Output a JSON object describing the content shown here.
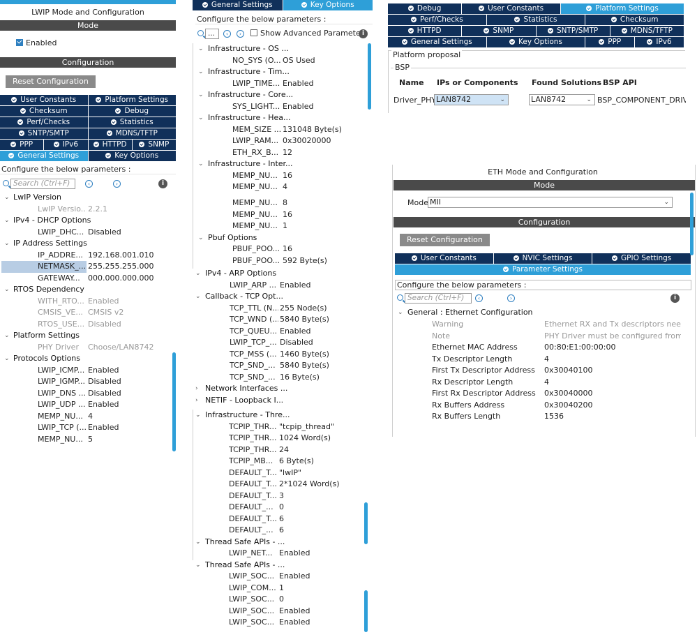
{
  "left": {
    "title": "LWIP Mode and Configuration",
    "mode_bar": "Mode",
    "enabled_label": "Enabled",
    "config_bar": "Configuration",
    "reset_button": "Reset Configuration",
    "tabs": [
      "User Constants",
      "Platform Settings",
      "Checksum",
      "Debug",
      "Perf/Checks",
      "Statistics",
      "SNTP/SMTP",
      "MDNS/TFTP",
      "PPP",
      "IPv6",
      "HTTPD",
      "SNMP",
      "General Settings",
      "Key Options"
    ],
    "hint": "Configure the below parameters :",
    "search_placeholder": "Search (Ctrl+F)",
    "rows": [
      {
        "t": "g",
        "k": "LwIP Version"
      },
      {
        "t": "p",
        "k": "LwIP Versio...",
        "v": "2.2.1",
        "dim": true
      },
      {
        "t": "g",
        "k": "IPv4 - DHCP Options"
      },
      {
        "t": "p",
        "k": "LWIP_DHC...",
        "v": "Disabled"
      },
      {
        "t": "g",
        "k": "IP Address Settings"
      },
      {
        "t": "p",
        "k": "IP_ADDRE...",
        "v": "192.168.001.010"
      },
      {
        "t": "p",
        "k": "NETMASK_...",
        "v": "255.255.255.000",
        "sel": true
      },
      {
        "t": "p",
        "k": "GATEWAY...",
        "v": "000.000.000.000"
      },
      {
        "t": "g",
        "k": "RTOS Dependency"
      },
      {
        "t": "p",
        "k": "WITH_RTO...",
        "v": "Enabled",
        "dim": true
      },
      {
        "t": "p",
        "k": "CMSIS_VE...",
        "v": "CMSIS v2",
        "dim": true
      },
      {
        "t": "p",
        "k": "RTOS_USE...",
        "v": "Disabled",
        "dim": true
      },
      {
        "t": "g",
        "k": "Platform Settings"
      },
      {
        "t": "p",
        "k": "PHY Driver",
        "v": "Choose/LAN8742",
        "dim": true
      },
      {
        "t": "g",
        "k": "Protocols Options"
      },
      {
        "t": "p",
        "k": "LWIP_ICMP...",
        "v": "Enabled"
      },
      {
        "t": "p",
        "k": "LWIP_IGMP...",
        "v": "Disabled"
      },
      {
        "t": "p",
        "k": "LWIP_DNS ...",
        "v": "Disabled"
      },
      {
        "t": "p",
        "k": "LWIP_UDP ...",
        "v": "Enabled"
      },
      {
        "t": "p",
        "k": "MEMP_NU...",
        "v": "4"
      },
      {
        "t": "p",
        "k": "LWIP_TCP (...",
        "v": "Enabled"
      },
      {
        "t": "p",
        "k": "MEMP_NU...",
        "v": "5"
      }
    ]
  },
  "middle": {
    "tabs": [
      "General Settings",
      "Key Options"
    ],
    "hint": "Configure the below parameters :",
    "search_value": "...",
    "advanced_label": "Show Advanced Parameters",
    "rows1": [
      {
        "t": "g",
        "k": "Infrastructure - OS ..."
      },
      {
        "t": "p",
        "k": "NO_SYS (O...",
        "v": "OS Used"
      },
      {
        "t": "g",
        "k": "Infrastructure - Tim..."
      },
      {
        "t": "p",
        "k": "LWIP_TIME...",
        "v": "Enabled"
      },
      {
        "t": "g",
        "k": "Infrastructure - Core..."
      },
      {
        "t": "p",
        "k": "SYS_LIGHT...",
        "v": "Enabled"
      },
      {
        "t": "g",
        "k": "Infrastructure - Hea..."
      },
      {
        "t": "p",
        "k": "MEM_SIZE ...",
        "v": "131048 Byte(s)"
      },
      {
        "t": "p",
        "k": "LWIP_RAM...",
        "v": "0x30020000"
      },
      {
        "t": "p",
        "k": "ETH_RX_B...",
        "v": "12"
      },
      {
        "t": "g",
        "k": "Infrastructure - Inter..."
      },
      {
        "t": "p",
        "k": "MEMP_NU...",
        "v": "16"
      },
      {
        "t": "p",
        "k": "MEMP_NU...",
        "v": "4"
      }
    ],
    "rows2": [
      {
        "t": "p",
        "k": "MEMP_NU...",
        "v": "8"
      },
      {
        "t": "p",
        "k": "MEMP_NU...",
        "v": "16"
      },
      {
        "t": "p",
        "k": "MEMP_NU...",
        "v": "1"
      },
      {
        "t": "g",
        "k": "Pbuf Options"
      },
      {
        "t": "p",
        "k": "PBUF_POO...",
        "v": "16"
      },
      {
        "t": "p",
        "k": "PBUF_POO...",
        "v": "592 Byte(s)"
      }
    ],
    "rows3": [
      {
        "t": "g",
        "k": "IPv4 - ARP Options"
      },
      {
        "t": "p",
        "k": "LWIP_ARP ...",
        "v": "Enabled"
      },
      {
        "t": "g",
        "k": "Callback - TCP Opt..."
      },
      {
        "t": "p",
        "k": "TCP_TTL (N...",
        "v": "255 Node(s)"
      },
      {
        "t": "p",
        "k": "TCP_WND (...",
        "v": "5840 Byte(s)"
      },
      {
        "t": "p",
        "k": "TCP_QUEU...",
        "v": "Enabled"
      },
      {
        "t": "p",
        "k": "LWIP_TCP_...",
        "v": "Disabled"
      },
      {
        "t": "p",
        "k": "TCP_MSS (...",
        "v": "1460 Byte(s)"
      },
      {
        "t": "p",
        "k": "TCP_SND_...",
        "v": "5840 Byte(s)"
      },
      {
        "t": "p",
        "k": "TCP_SND_...",
        "v": "16 Byte(s)"
      },
      {
        "t": "c",
        "k": "Network Interfaces ..."
      },
      {
        "t": "c",
        "k": "NETIF - Loopback I..."
      }
    ],
    "rows4": [
      {
        "t": "g",
        "k": "Infrastructure - Thre..."
      },
      {
        "t": "p",
        "k": "TCPIP_THR...",
        "v": "\"tcpip_thread\""
      },
      {
        "t": "p",
        "k": "TCPIP_THR...",
        "v": "1024 Word(s)"
      },
      {
        "t": "p",
        "k": "TCPIP_THR...",
        "v": "24"
      },
      {
        "t": "p",
        "k": "TCPIP_MB...",
        "v": "6 Byte(s)"
      },
      {
        "t": "p",
        "k": "DEFAULT_T...",
        "v": "\"lwIP\""
      },
      {
        "t": "p",
        "k": "DEFAULT_T...",
        "v": "2*1024 Word(s)"
      },
      {
        "t": "p",
        "k": "DEFAULT_T...",
        "v": "3"
      },
      {
        "t": "p",
        "k": "DEFAULT_...",
        "v": "0"
      },
      {
        "t": "p",
        "k": "DEFAULT_T...",
        "v": "6"
      },
      {
        "t": "p",
        "k": "DEFAULT_...",
        "v": "6"
      },
      {
        "t": "g",
        "k": "Thread Safe APIs - ..."
      },
      {
        "t": "p",
        "k": "LWIP_NET...",
        "v": "Enabled"
      },
      {
        "t": "g",
        "k": "Thread Safe APIs - ..."
      },
      {
        "t": "p",
        "k": "LWIP_SOC...",
        "v": "Enabled"
      },
      {
        "t": "p",
        "k": "LWIP_COM...",
        "v": "1"
      },
      {
        "t": "p",
        "k": "LWIP_SOC...",
        "v": "0"
      },
      {
        "t": "p",
        "k": "LWIP_SOC...",
        "v": "Enabled"
      },
      {
        "t": "p",
        "k": "LWIP_SOC...",
        "v": "Enabled"
      }
    ]
  },
  "platform": {
    "tabs": [
      "Debug",
      "User Constants",
      "Platform Settings",
      "Perf/Checks",
      "Statistics",
      "Checksum",
      "HTTPD",
      "SNMP",
      "SNTP/SMTP",
      "MDNS/TFTP",
      "General Settings",
      "Key Options",
      "PPP",
      "IPv6"
    ],
    "proposal_label": "Platform proposal",
    "bsp_label": "BSP",
    "headers": [
      "Name",
      "IPs or Components",
      "Found Solutions",
      "BSP API"
    ],
    "row": {
      "name": "Driver_PHY",
      "component": "LAN8742",
      "solution": "LAN8742",
      "api": "BSP_COMPONENT_DRIVER"
    }
  },
  "eth": {
    "title": "ETH Mode and Configuration",
    "mode_bar": "Mode",
    "mode_label": "Mode",
    "mode_value": "MII",
    "config_bar": "Configuration",
    "reset_button": "Reset Configuration",
    "tabs": [
      "User Constants",
      "NVIC Settings",
      "GPIO Settings",
      "Parameter Settings"
    ],
    "hint": "Configure the below parameters :",
    "search_placeholder": "Search (Ctrl+F)",
    "group": "General : Ethernet Configuration",
    "rows": [
      {
        "k": "Warning",
        "v": "Ethernet RX and Tx descriptors needs to ...",
        "dim": true
      },
      {
        "k": "Note",
        "v": "PHY Driver must be configured from the L...",
        "dim": true
      },
      {
        "k": "Ethernet MAC Address",
        "v": "00:80:E1:00:00:00"
      },
      {
        "k": "Tx Descriptor Length",
        "v": "4"
      },
      {
        "k": "First Tx Descriptor Address",
        "v": "0x30040100"
      },
      {
        "k": "Rx Descriptor Length",
        "v": "4"
      },
      {
        "k": "First Rx Descriptor Address",
        "v": "0x30040000"
      },
      {
        "k": "Rx Buffers Address",
        "v": "0x30040200"
      },
      {
        "k": "Rx Buffers Length",
        "v": "1536"
      }
    ]
  },
  "colors": {
    "accent": "#2e9fd8",
    "tab_dark": "#10305a",
    "bar_dark": "#4a4a4a",
    "selection": "#b8cde4"
  }
}
